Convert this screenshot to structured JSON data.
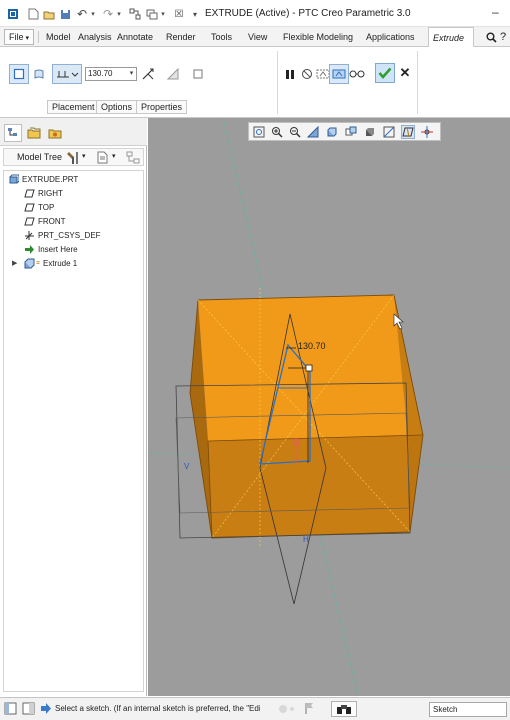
{
  "window": {
    "title": "EXTRUDE (Active) - PTC Creo Parametric 3.0"
  },
  "ribbon_tabs": [
    "Model",
    "Analysis",
    "Annotate",
    "Render",
    "Tools",
    "View",
    "Flexible Modeling",
    "Applications"
  ],
  "file_menu": "File",
  "active_tab": "Extrude",
  "dashboard": {
    "depth_value": "130.70",
    "tabs": [
      "Placement",
      "Options",
      "Properties"
    ]
  },
  "model_tree": {
    "title": "Model Tree",
    "items": [
      {
        "label": "EXTRUDE.PRT",
        "icon": "part-icon"
      },
      {
        "label": "RIGHT",
        "icon": "datum-plane-icon"
      },
      {
        "label": "TOP",
        "icon": "datum-plane-icon"
      },
      {
        "label": "FRONT",
        "icon": "datum-plane-icon"
      },
      {
        "label": "PRT_CSYS_DEF",
        "icon": "csys-icon"
      },
      {
        "label": "Insert Here",
        "icon": "insert-arrow-icon"
      },
      {
        "label": "Extrude 1",
        "icon": "extrude-feature-icon"
      }
    ]
  },
  "viewport": {
    "dimension_label": "130.70",
    "datum_labels": {
      "v": "V",
      "h": "H"
    }
  },
  "status_bar": {
    "message": "Select a sketch. (If an internal sketch is preferred, the \"Edit",
    "filter_value": "Sketch"
  },
  "colors": {
    "solid_orange": "#d9850f",
    "selection_blue": "#2b6fc5",
    "graphics_bg": "#9c9c9c"
  }
}
